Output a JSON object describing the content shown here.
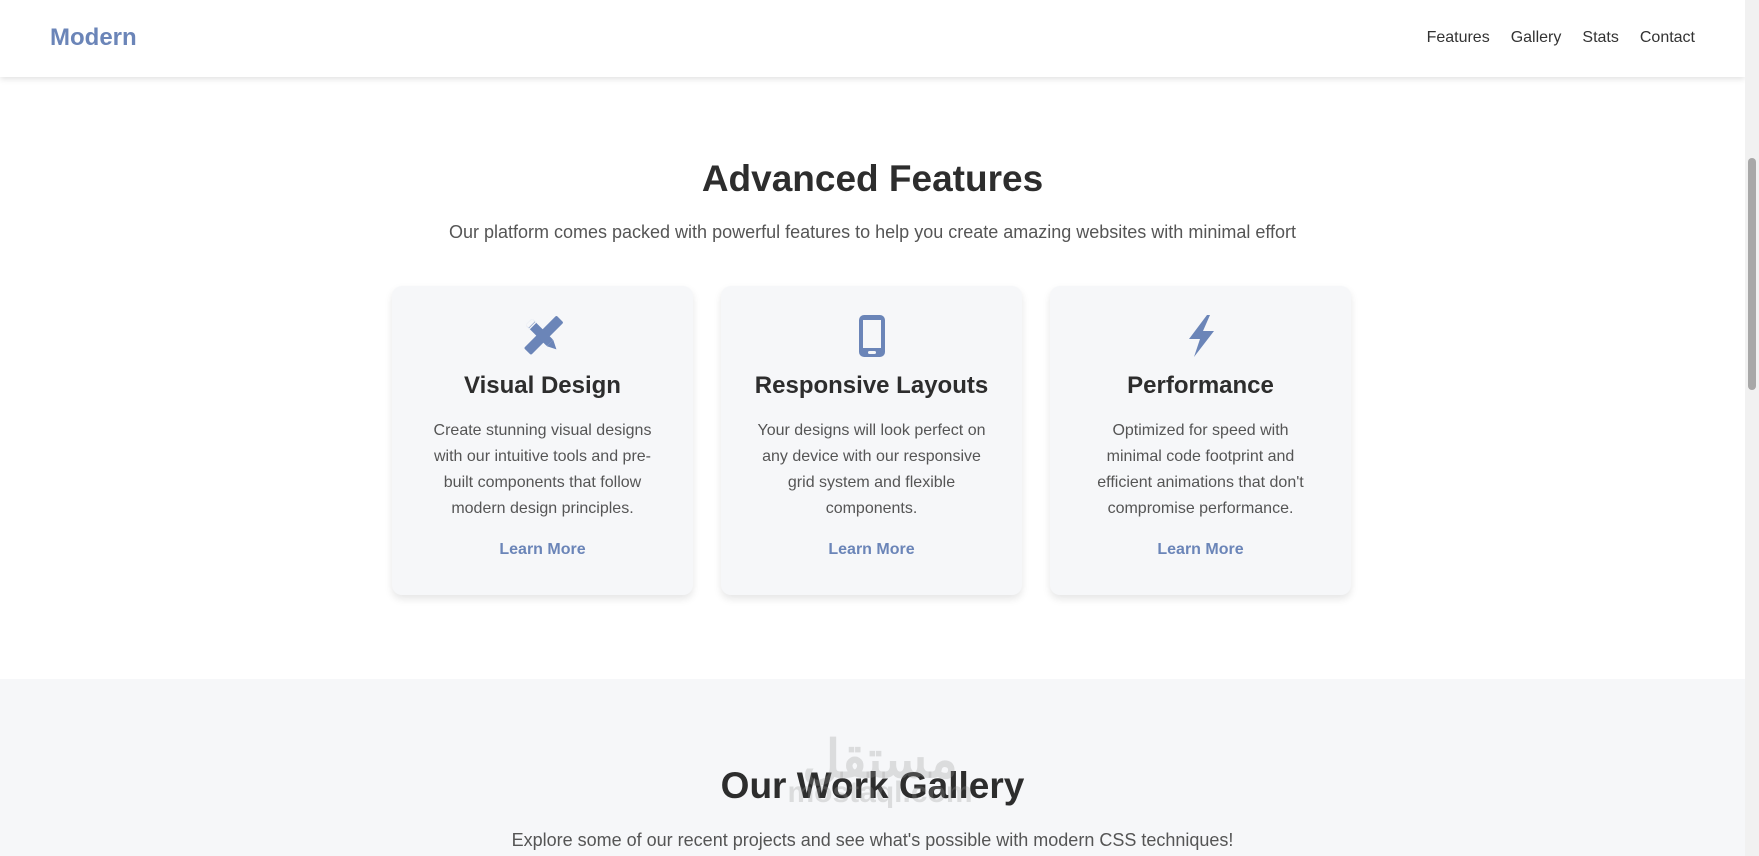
{
  "header": {
    "logo": "Modern",
    "nav": [
      "Features",
      "Gallery",
      "Stats",
      "Contact"
    ]
  },
  "features": {
    "title": "Advanced Features",
    "subtitle": "Our platform comes packed with powerful features to help you create amazing websites with minimal effort",
    "cards": [
      {
        "icon": "pencil-ruler-icon",
        "title": "Visual Design",
        "text": "Create stunning visual designs with our intuitive tools and pre-built components that follow modern design principles.",
        "link": "Learn More"
      },
      {
        "icon": "mobile-phone-icon",
        "title": "Responsive Layouts",
        "text": "Your designs will look perfect on any device with our responsive grid system and flexible components.",
        "link": "Learn More"
      },
      {
        "icon": "lightning-bolt-icon",
        "title": "Performance",
        "text": "Optimized for speed with minimal code footprint and efficient animations that don't compromise performance.",
        "link": "Learn More"
      }
    ]
  },
  "gallery": {
    "title": "Our Work Gallery",
    "subtitle": "Explore some of our recent projects and see what's possible with modern CSS techniques!"
  },
  "watermark": {
    "arabic": "مستقل",
    "latin": "mostaql.com"
  },
  "colors": {
    "accent": "#6b85b8",
    "text": "#2d2d2d",
    "muted": "#555555",
    "card_bg": "#f6f7f9"
  }
}
